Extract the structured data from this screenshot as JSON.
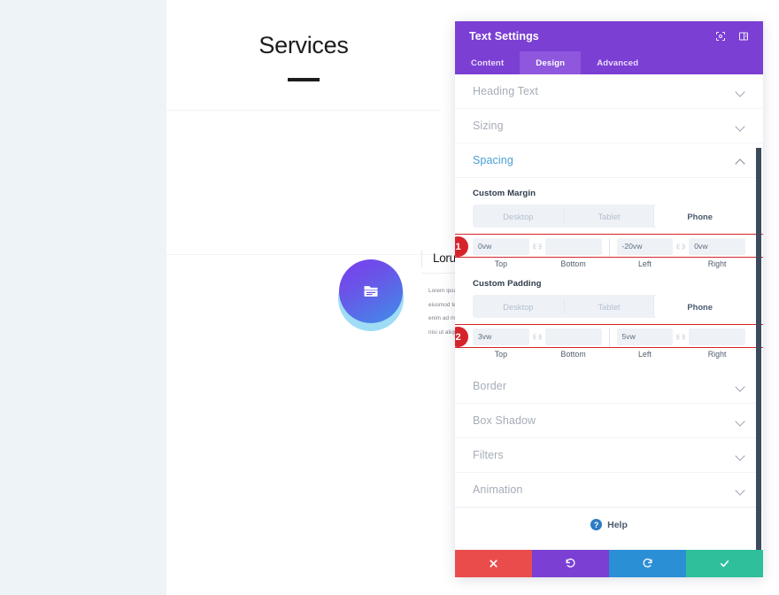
{
  "preview": {
    "section_title": "Services",
    "card": {
      "icon": "folder-icon",
      "heading": "Lorum ipsum dolor",
      "body": "Lorem ipsum dolor sit amet, consectetur adipiscing elit, sed do eiusmod tempor incididunt ut labore et dolore magna aliqua. Ut enim ad minim veniam, quis nostrud exercitation ullamco laboris nisi ut aliquip ex ea commodo consequat."
    }
  },
  "panel": {
    "title": "Text Settings",
    "header_icons": [
      {
        "name": "expand-icon"
      },
      {
        "name": "layout-toggle-icon"
      }
    ],
    "tabs": [
      {
        "label": "Content",
        "active": false
      },
      {
        "label": "Design",
        "active": true
      },
      {
        "label": "Advanced",
        "active": false
      }
    ],
    "sections": {
      "heading_text": "Heading Text",
      "sizing": "Sizing",
      "spacing": "Spacing",
      "border": "Border",
      "box_shadow": "Box Shadow",
      "filters": "Filters",
      "animation": "Animation"
    },
    "spacing": {
      "margin": {
        "label": "Custom Margin",
        "devices": [
          {
            "label": "Desktop",
            "active": false
          },
          {
            "label": "Tablet",
            "active": false
          },
          {
            "label": "Phone",
            "active": true
          }
        ],
        "step": "1",
        "fields": [
          {
            "caption": "Top",
            "value": "0vw",
            "placeholder": ""
          },
          {
            "caption": "Bottom",
            "value": "",
            "placeholder": ""
          },
          {
            "caption": "Left",
            "value": "-20vw",
            "placeholder": ""
          },
          {
            "caption": "Right",
            "value": "0vw",
            "placeholder": ""
          }
        ]
      },
      "padding": {
        "label": "Custom Padding",
        "devices": [
          {
            "label": "Desktop",
            "active": false
          },
          {
            "label": "Tablet",
            "active": false
          },
          {
            "label": "Phone",
            "active": true
          }
        ],
        "step": "2",
        "fields": [
          {
            "caption": "Top",
            "value": "3vw",
            "placeholder": ""
          },
          {
            "caption": "Bottom",
            "value": "",
            "placeholder": ""
          },
          {
            "caption": "Left",
            "value": "5vw",
            "placeholder": ""
          },
          {
            "caption": "Right",
            "value": "",
            "placeholder": ""
          }
        ]
      }
    },
    "help": {
      "label": "Help",
      "glyph": "?"
    },
    "footer_buttons": [
      {
        "name": "cancel-button",
        "glyph": "✕",
        "color": "#ea4c4c"
      },
      {
        "name": "undo-button",
        "glyph": "↺",
        "color": "#7b3fd4"
      },
      {
        "name": "redo-button",
        "glyph": "↻",
        "color": "#2b8fd6"
      },
      {
        "name": "save-button",
        "glyph": "✓",
        "color": "#2fbf9b"
      }
    ]
  },
  "colors": {
    "panel_header": "#7b3fd4",
    "tab_active": "#8e57de",
    "accent_blue": "#4a9fd4",
    "badge_red": "#d6232a",
    "page_bg": "#eef3f8"
  }
}
